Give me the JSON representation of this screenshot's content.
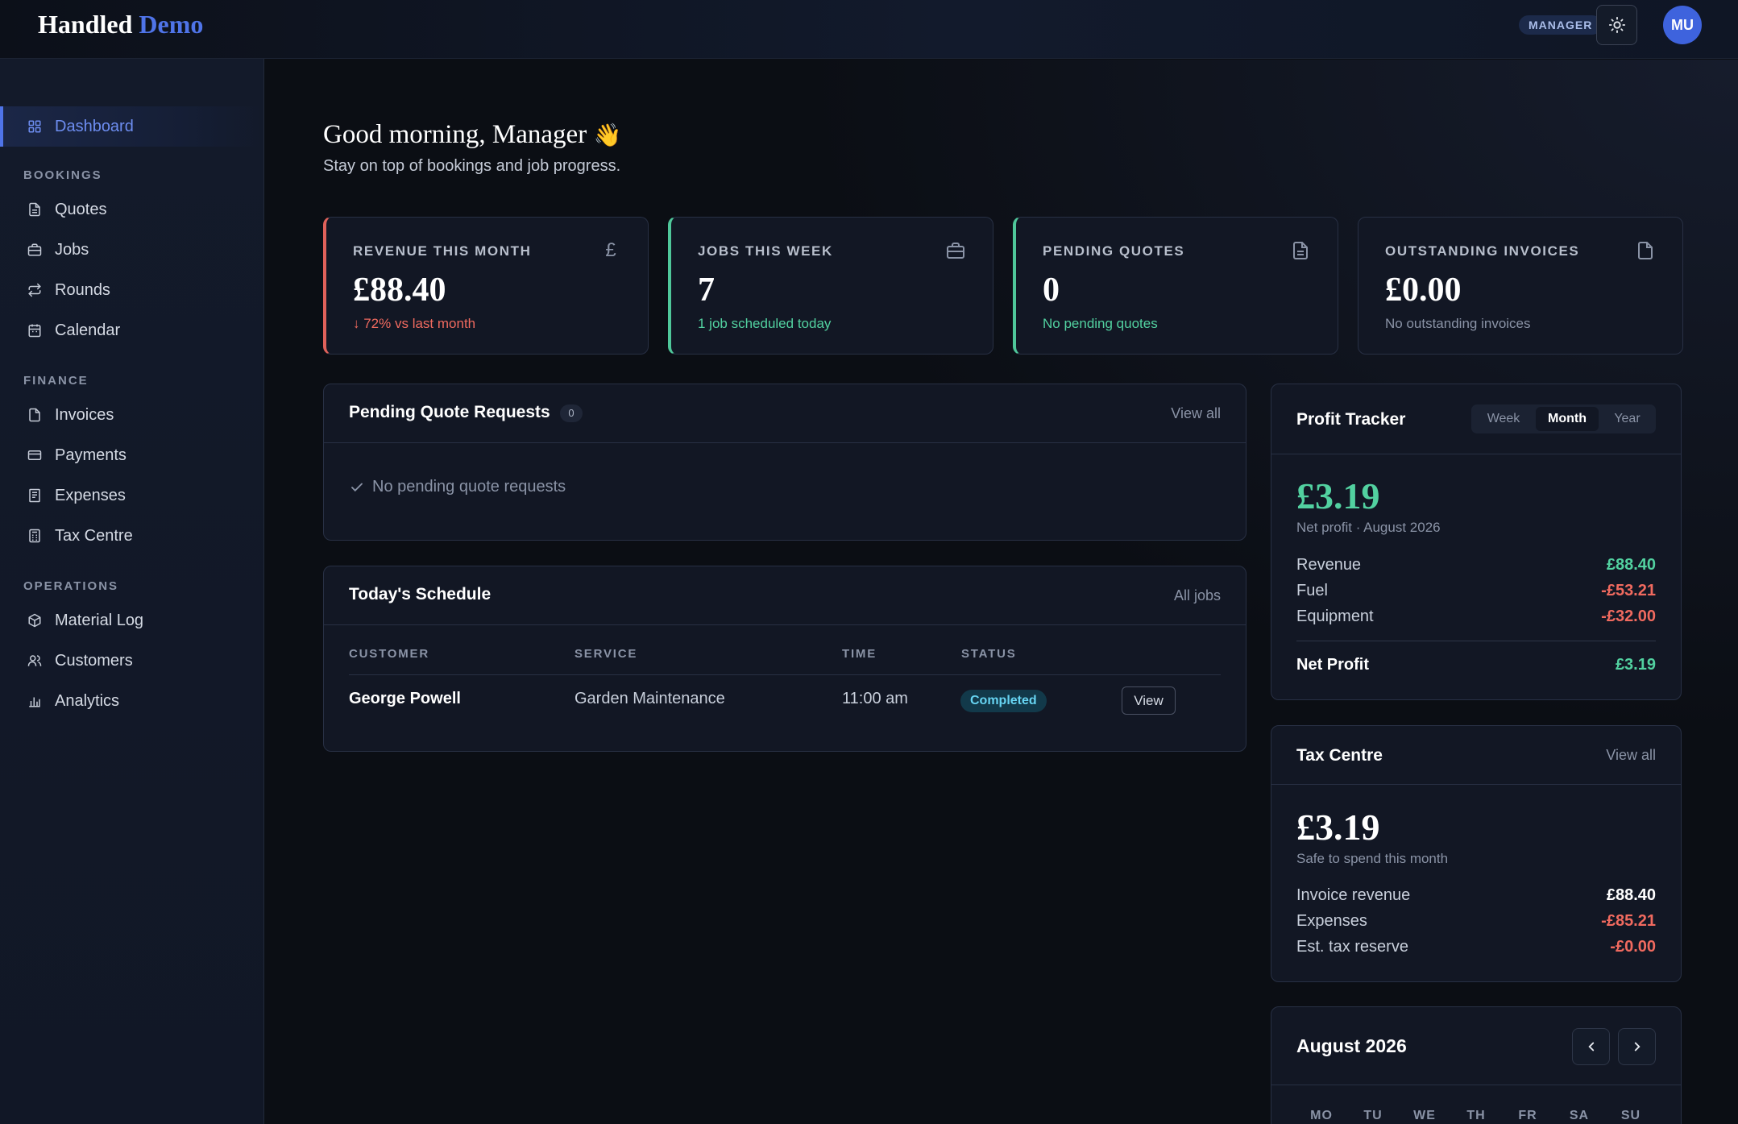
{
  "header": {
    "brand_main": "Handled",
    "brand_accent": "Demo",
    "role_badge": "MANAGER",
    "avatar_initials": "MU"
  },
  "sidebar": {
    "dashboard": "Dashboard",
    "sections": {
      "bookings": "BOOKINGS",
      "finance": "FINANCE",
      "operations": "OPERATIONS"
    },
    "items": {
      "quotes": "Quotes",
      "jobs": "Jobs",
      "rounds": "Rounds",
      "calendar": "Calendar",
      "invoices": "Invoices",
      "payments": "Payments",
      "expenses": "Expenses",
      "tax_centre": "Tax Centre",
      "material_log": "Material Log",
      "customers": "Customers",
      "analytics": "Analytics"
    }
  },
  "greeting": {
    "title": "Good morning, Manager",
    "emoji": "👋",
    "subtitle": "Stay on top of bookings and job progress."
  },
  "stats": [
    {
      "label": "REVENUE THIS MONTH",
      "value": "£88.40",
      "sub": "↓ 72% vs last month",
      "icon": "pound-icon"
    },
    {
      "label": "JOBS THIS WEEK",
      "value": "7",
      "sub": "1 job scheduled today",
      "icon": "briefcase-icon"
    },
    {
      "label": "PENDING QUOTES",
      "value": "0",
      "sub": "No pending quotes",
      "icon": "document-icon"
    },
    {
      "label": "OUTSTANDING INVOICES",
      "value": "£0.00",
      "sub": "No outstanding invoices",
      "icon": "file-icon"
    }
  ],
  "pending_quotes": {
    "title": "Pending Quote Requests",
    "count": "0",
    "link": "View all",
    "empty": "No pending quote requests"
  },
  "schedule": {
    "title": "Today's Schedule",
    "link": "All jobs",
    "columns": [
      "CUSTOMER",
      "SERVICE",
      "TIME",
      "STATUS"
    ],
    "rows": [
      {
        "customer": "George Powell",
        "service": "Garden Maintenance",
        "time": "11:00 am",
        "status": "Completed",
        "action": "View"
      }
    ]
  },
  "profit": {
    "title": "Profit Tracker",
    "tabs": [
      "Week",
      "Month",
      "Year"
    ],
    "active_tab": "Month",
    "amount": "£3.19",
    "caption": "Net profit · August 2026",
    "rows": [
      {
        "label": "Revenue",
        "value": "£88.40"
      },
      {
        "label": "Fuel",
        "value": "-£53.21"
      },
      {
        "label": "Equipment",
        "value": "-£32.00"
      }
    ],
    "net_label": "Net Profit",
    "net_value": "£3.19"
  },
  "tax": {
    "title": "Tax Centre",
    "link": "View all",
    "amount": "£3.19",
    "caption": "Safe to spend this month",
    "rows": [
      {
        "label": "Invoice revenue",
        "value": "£88.40"
      },
      {
        "label": "Expenses",
        "value": "-£85.21"
      },
      {
        "label": "Est. tax reserve",
        "value": "-£0.00"
      }
    ]
  },
  "calendar": {
    "title": "August 2026",
    "days": [
      "MO",
      "TU",
      "WE",
      "TH",
      "FR",
      "SA",
      "SU"
    ]
  },
  "colors": {
    "accent": "#4f74e8",
    "positive": "#52d1a0",
    "negative": "#f06a5f",
    "status_completed": "#67d4f2"
  }
}
